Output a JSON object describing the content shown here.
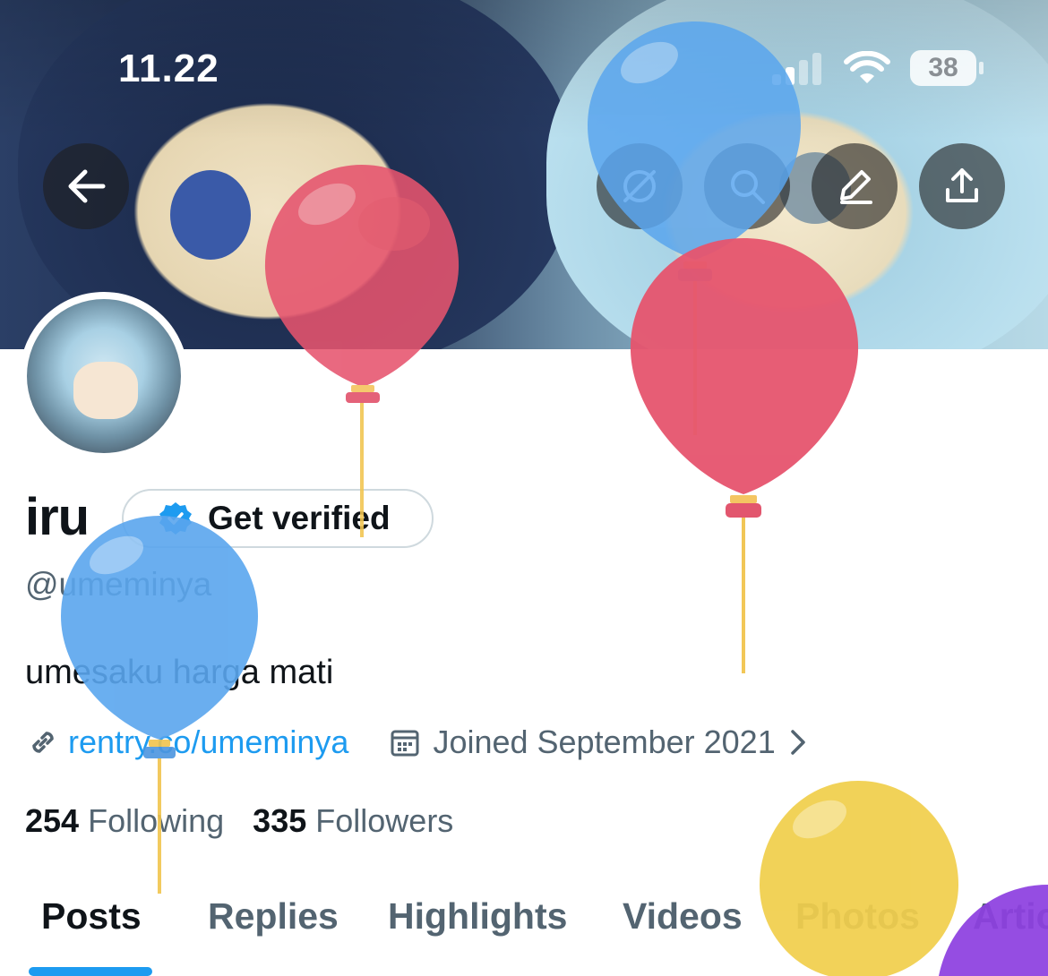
{
  "status": {
    "time": "11.22",
    "battery": "38"
  },
  "profile": {
    "name": "iru",
    "verify_label": "Get verified",
    "handle": "@umeminya",
    "bio": "umesaku harga mati",
    "link": "rentry.co/umeminya",
    "joined": "Joined September 2021",
    "following_count": "254",
    "following_label": "Following",
    "followers_count": "335",
    "followers_label": "Followers"
  },
  "tabs": [
    {
      "label": "Posts"
    },
    {
      "label": "Replies"
    },
    {
      "label": "Highlights"
    },
    {
      "label": "Videos"
    },
    {
      "label": "Photos"
    },
    {
      "label": "Artic"
    }
  ],
  "icons": {
    "back": "back-arrow-icon",
    "grok": "grok-icon",
    "search": "search-icon",
    "edit": "pencil-icon",
    "share": "share-icon",
    "link": "link-icon",
    "calendar": "calendar-icon"
  },
  "colors": {
    "accent": "#1d9bf0",
    "balloon_red": "#e6546e",
    "balloon_blue": "#5aa6ee",
    "balloon_yellow": "#f1cf4c",
    "balloon_purple": "#8d3fe0"
  }
}
